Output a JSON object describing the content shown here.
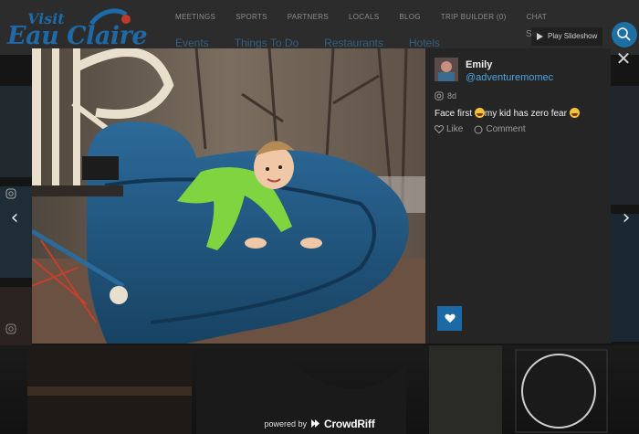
{
  "site": {
    "logo_visit": "Visit",
    "logo_city": "Eau Claire",
    "top_nav": [
      "MEETINGS",
      "SPORTS",
      "PARTNERS",
      "LOCALS",
      "BLOG",
      "TRIP BUILDER (0)",
      "CHAT"
    ],
    "sub_nav": [
      "Events",
      "Things To Do",
      "Restaurants",
      "Hotels"
    ],
    "search_text": "Se"
  },
  "modal": {
    "play_slideshow": "Play Slideshow",
    "close_glyph": "✕",
    "prev_glyph": "‹",
    "next_glyph": "›"
  },
  "post": {
    "user_name": "Emily",
    "handle": "@adventuremomec",
    "age": "8d",
    "caption_before": "Face first ",
    "caption_middle": "my kid has zero fear ",
    "like_label": "Like",
    "comment_label": "Comment"
  },
  "footer": {
    "powered_by": "powered by",
    "brand": "CrowdRiff"
  },
  "colors": {
    "accent": "#1b6aa5",
    "handle": "#4ea3e0",
    "slide": "#1f4e7a",
    "jacket": "#78d23a"
  },
  "icons": [
    "instagram-icon",
    "heart-outline-icon",
    "comment-icon",
    "heart-icon",
    "play-icon",
    "close-icon",
    "chevron-left-icon",
    "chevron-right-icon",
    "crowdriff-logo"
  ]
}
